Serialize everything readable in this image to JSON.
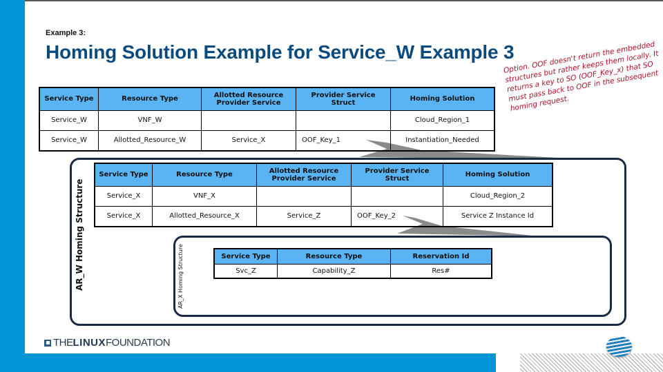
{
  "header": {
    "subtitle": "Example 3:",
    "title": "Homing Solution Example for Service_W Example 3"
  },
  "colors": {
    "brand_blue": "#0096d6",
    "title_blue": "#0b4a7c",
    "table_header": "#5ab4f4",
    "note_red": "#b0102a",
    "box_border": "#1a2a44"
  },
  "table_w": {
    "headers": [
      "Service Type",
      "Resource Type",
      "Allotted Resource Provider Service",
      "Provider Service Struct",
      "Homing Solution"
    ],
    "rows": [
      [
        "Service_W",
        "VNF_W",
        "",
        "",
        "Cloud_Region_1"
      ],
      [
        "Service_W",
        "Allotted_Resource_W",
        "Service_X",
        "OOF_Key_1",
        "Instantiation_Needed"
      ]
    ]
  },
  "box_w": {
    "label": "AR_W Homing Structure"
  },
  "table_x": {
    "headers": [
      "Service Type",
      "Resource Type",
      "Allotted Resource Provider Service",
      "Provider Service Struct",
      "Homing Solution"
    ],
    "rows": [
      [
        "Service_X",
        "VNF_X",
        "",
        "",
        "Cloud_Region_2"
      ],
      [
        "Service_X",
        "Allotted_Resource_X",
        "Service_Z",
        "OOF_Key_2",
        "Service Z Instance Id"
      ]
    ]
  },
  "box_x": {
    "label": "AR_X Homing Structure"
  },
  "table_z": {
    "headers": [
      "Service Type",
      "Resource Type",
      "Reservation Id"
    ],
    "rows": [
      [
        "Svc_Z",
        "Capability_Z",
        "Res#"
      ]
    ]
  },
  "note": {
    "text": "Option. OOF doesn't return the embedded structures but rather keeps them locally.  It returns a key to SO (OOF_Key_x) that SO must pass back to OOF in the subsequent homing request."
  },
  "footer": {
    "logo_the": "THE",
    "logo_linux": "LINUX",
    "logo_foundation": "FOUNDATION",
    "att_logo": "att-globe-icon"
  }
}
